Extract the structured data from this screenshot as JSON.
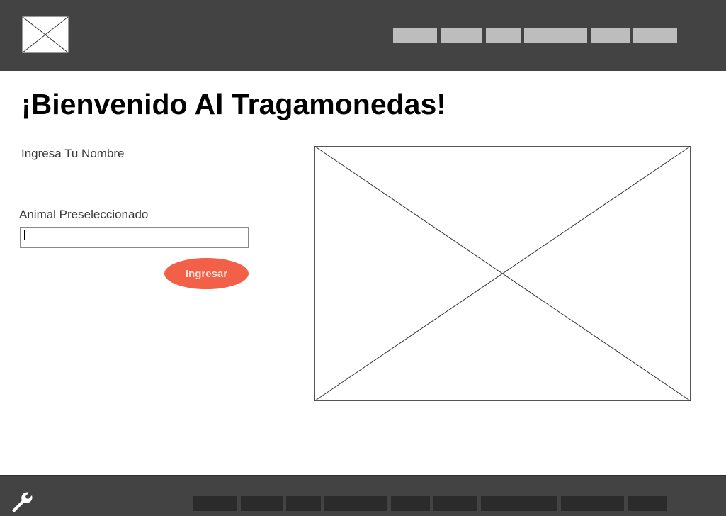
{
  "header": {
    "logo_icon": "image-placeholder-icon",
    "nav_items": [
      "",
      "",
      "",
      "",
      "",
      ""
    ],
    "nav_color": "#bdbdbd",
    "background": "#434343"
  },
  "main": {
    "title": "¡Bienvenido Al Tragamonedas!",
    "name_field": {
      "label": "Ingresa Tu Nombre",
      "value": "",
      "placeholder": ""
    },
    "animal_field": {
      "label": "Animal Preseleccionado",
      "value": "",
      "placeholder": ""
    },
    "submit_label": "Ingresar",
    "submit_color": "#f26047",
    "image_icon": "image-placeholder-icon"
  },
  "footer": {
    "tool_icon": "wrench-icon",
    "links": [
      "",
      "",
      "",
      "",
      "",
      "",
      "",
      "",
      ""
    ],
    "background": "#434343"
  }
}
